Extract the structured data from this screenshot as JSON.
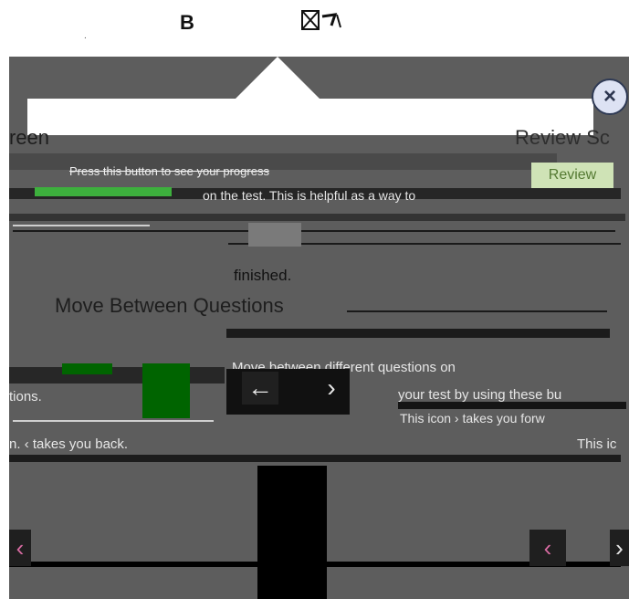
{
  "top": {
    "letter_b": "B",
    "dot": "."
  },
  "screen": {
    "header_left": "reen",
    "header_right": "Review Sc",
    "review_button": "Review",
    "progress_hint": "Press this button to see your progress",
    "test_status": "on the test. This is helpful as a way to",
    "finished": "finished.",
    "move_title": "Move Between Questions",
    "move_body_1": "Move between different questions on",
    "move_body_2": "your test by using these bu",
    "move_body_3": "This icon",
    "move_body_3b": "takes you forw",
    "left_tions": "tions.",
    "back_text": "n.",
    "back_text_2": "takes you back.",
    "this_ic": "This ic"
  },
  "icons": {
    "close": "×",
    "left_arrow": "←",
    "right_chevron": "›",
    "back_chevron": "‹",
    "fwd_small": "›"
  },
  "colors": {
    "stage": "#5d5d5d",
    "accent_green": "#3db03d",
    "review_bg": "#cfe3b6",
    "review_text": "#557a33",
    "close_bg": "#dde2f3",
    "arrow_pink": "#d56aa0"
  }
}
